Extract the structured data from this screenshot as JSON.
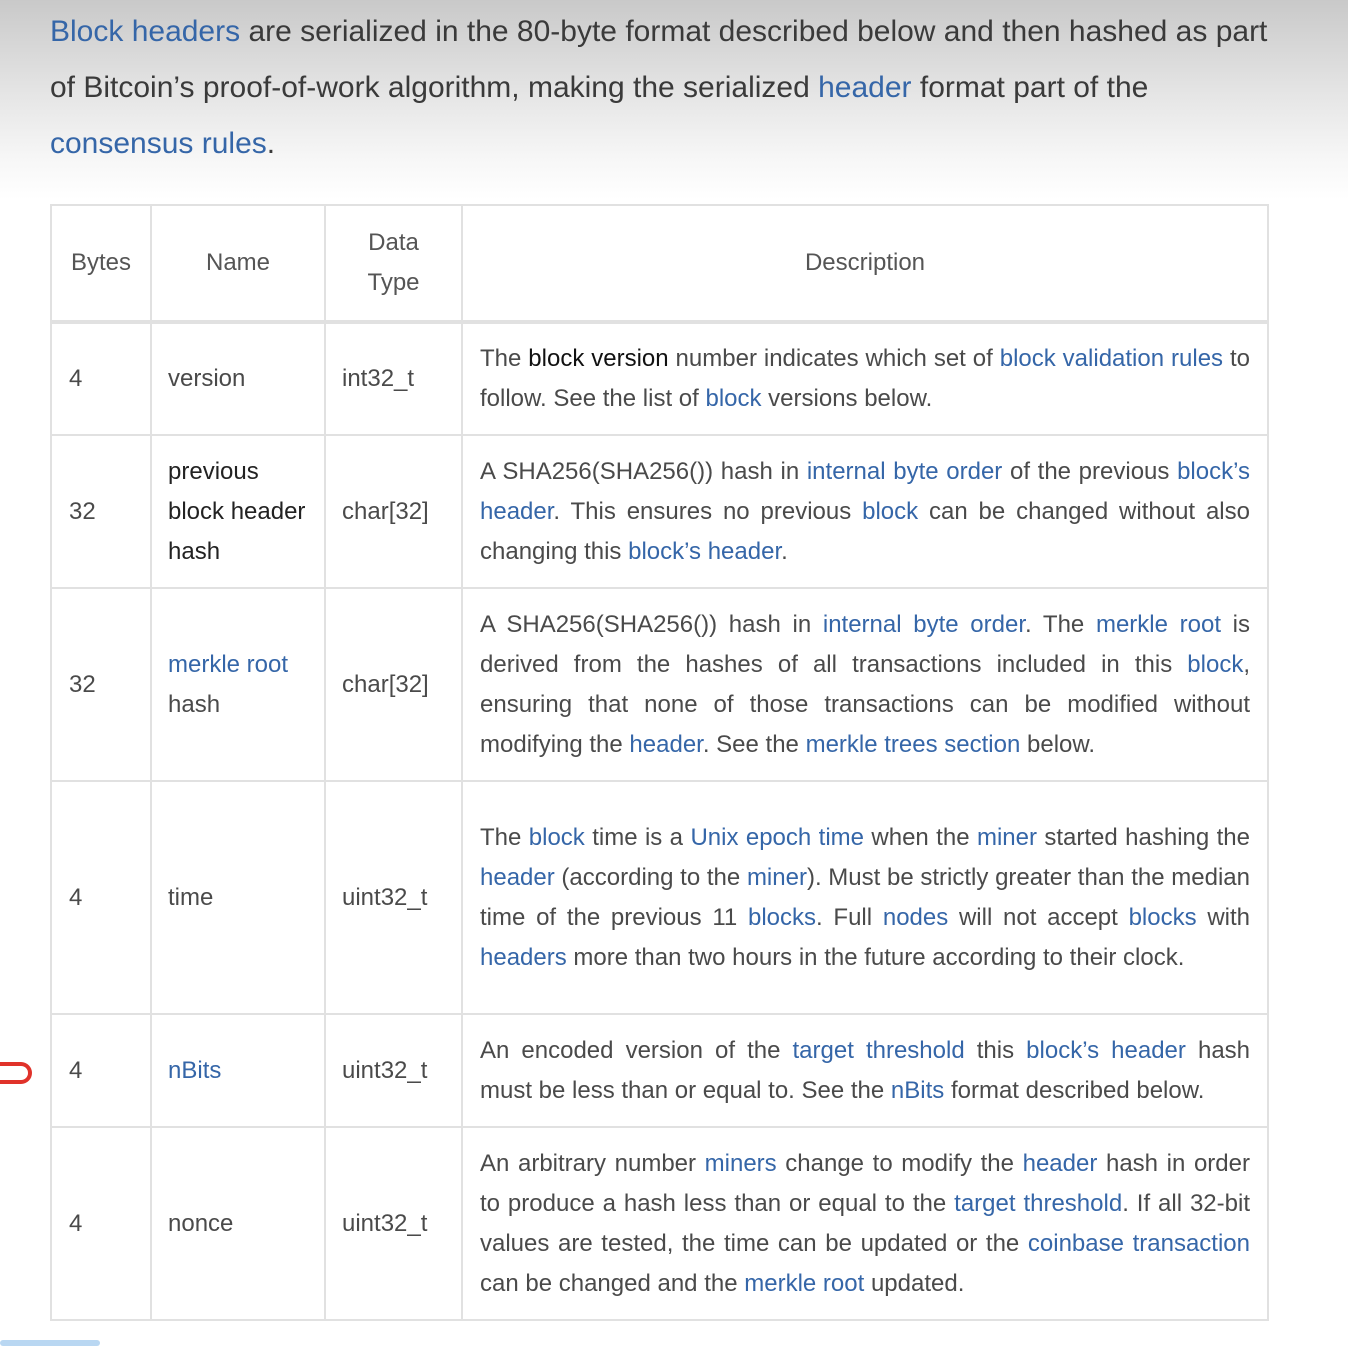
{
  "intro": {
    "t1": "Block headers",
    "t2": " are serialized in the 80-byte format described below and then hashed as part of Bitcoin’s proof-of-work algorithm, making the serialized ",
    "t3": "header",
    "t4": " format part of the ",
    "t5": "consensus rules",
    "t6": "."
  },
  "table": {
    "headers": {
      "bytes": "Bytes",
      "name": "Name",
      "type": "Data Type",
      "desc": "Description"
    },
    "rows": [
      {
        "bytes": "4",
        "name": "version",
        "type": "int32_t",
        "d": [
          "The ",
          "block version",
          " number indicates which set of ",
          "block validation rules",
          " to follow. See the list of ",
          "block",
          " versions below."
        ]
      },
      {
        "bytes": "32",
        "name": "previous block header hash",
        "type": "char[32]",
        "d": [
          "A SHA256(SHA256()) hash in ",
          "internal byte order",
          " of the previous ",
          "block’s header",
          ". This ensures no previous ",
          "block",
          " can be changed without also changing this ",
          "block’s header",
          "."
        ]
      },
      {
        "bytes": "32",
        "name_link": "merkle root",
        "name_rest": " hash",
        "type": "char[32]",
        "d": [
          "A SHA256(SHA256()) hash in ",
          "internal byte order",
          ". The ",
          "merkle root",
          " is derived from the hashes of all transactions included in this ",
          "block",
          ", ensuring that none of those transactions can be modified without modifying the ",
          "header",
          ". See the ",
          "merkle trees section",
          " below."
        ]
      },
      {
        "bytes": "4",
        "name": "time",
        "type": "uint32_t",
        "d": [
          "The ",
          "block",
          " time is a ",
          "Unix epoch time",
          " when the ",
          "miner",
          " started hashing the ",
          "header",
          " (according to the ",
          "miner",
          "). Must be strictly greater than the median time of the previous 11 ",
          "blocks",
          ". Full ",
          "nodes",
          " will not accept ",
          "blocks",
          " with ",
          "headers",
          " more than two hours in the future according to their clock."
        ]
      },
      {
        "bytes": "4",
        "name": "nBits",
        "type": "uint32_t",
        "d": [
          "An encoded version of the ",
          "target threshold",
          " this ",
          "block’s header",
          " hash must be less than or equal to. See the ",
          "nBits",
          " format described below."
        ]
      },
      {
        "bytes": "4",
        "name": "nonce",
        "type": "uint32_t",
        "d": [
          "An arbitrary number ",
          "miners",
          " change to modify the ",
          "header",
          " hash in order to produce a hash less than or equal to the ",
          "target threshold",
          ". If all 32-bit values are tested, the time can be updated or the ",
          "coinbase transaction",
          " can be changed and the ",
          "merkle root",
          " updated."
        ]
      }
    ]
  }
}
